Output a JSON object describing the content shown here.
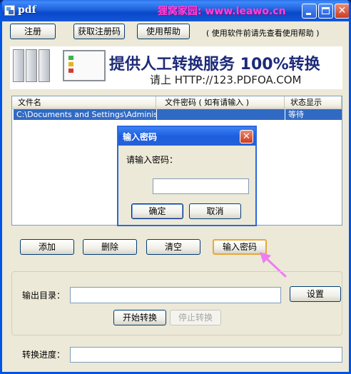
{
  "window": {
    "title": "pdf",
    "watermark": "狸窝家园: www.leawo.cn",
    "close_glyph": "✕"
  },
  "toolbar": {
    "register_label": "注册",
    "get_code_label": "获取注册码",
    "help_label": "使用帮助",
    "hint_text": "( 使用软件前请先查看使用帮助 )"
  },
  "banner": {
    "main_text": "提供人工转换服务 100%转换",
    "sub_text": "请上  HTTP://123.PDFOA.COM"
  },
  "file_list": {
    "columns": [
      "文件名",
      "文件密码 ( 如有请输入 )",
      "状态显示"
    ],
    "rows": [
      {
        "name": "C:\\Documents and Settings\\Administr...",
        "password": "",
        "status": "等待"
      }
    ]
  },
  "password_dialog": {
    "title": "输入密码",
    "prompt": "请输入密码：",
    "input_value": "",
    "ok_label": "确定",
    "cancel_label": "取消"
  },
  "actions": {
    "add_label": "添加",
    "delete_label": "删除",
    "clear_label": "清空",
    "enter_password_label": "输入密码"
  },
  "output": {
    "dir_label": "输出目录：",
    "dir_value": "",
    "settings_label": "设置",
    "start_label": "开始转换",
    "stop_label": "停止转换"
  },
  "progress": {
    "label": "转换进度："
  },
  "colors": {
    "titlebar": "#0054e3",
    "selection": "#316ac5",
    "watermark": "#ff44d8",
    "highlight_border": "#e8a83a",
    "arrow": "#f07cf0",
    "face": "#ece9d8"
  }
}
